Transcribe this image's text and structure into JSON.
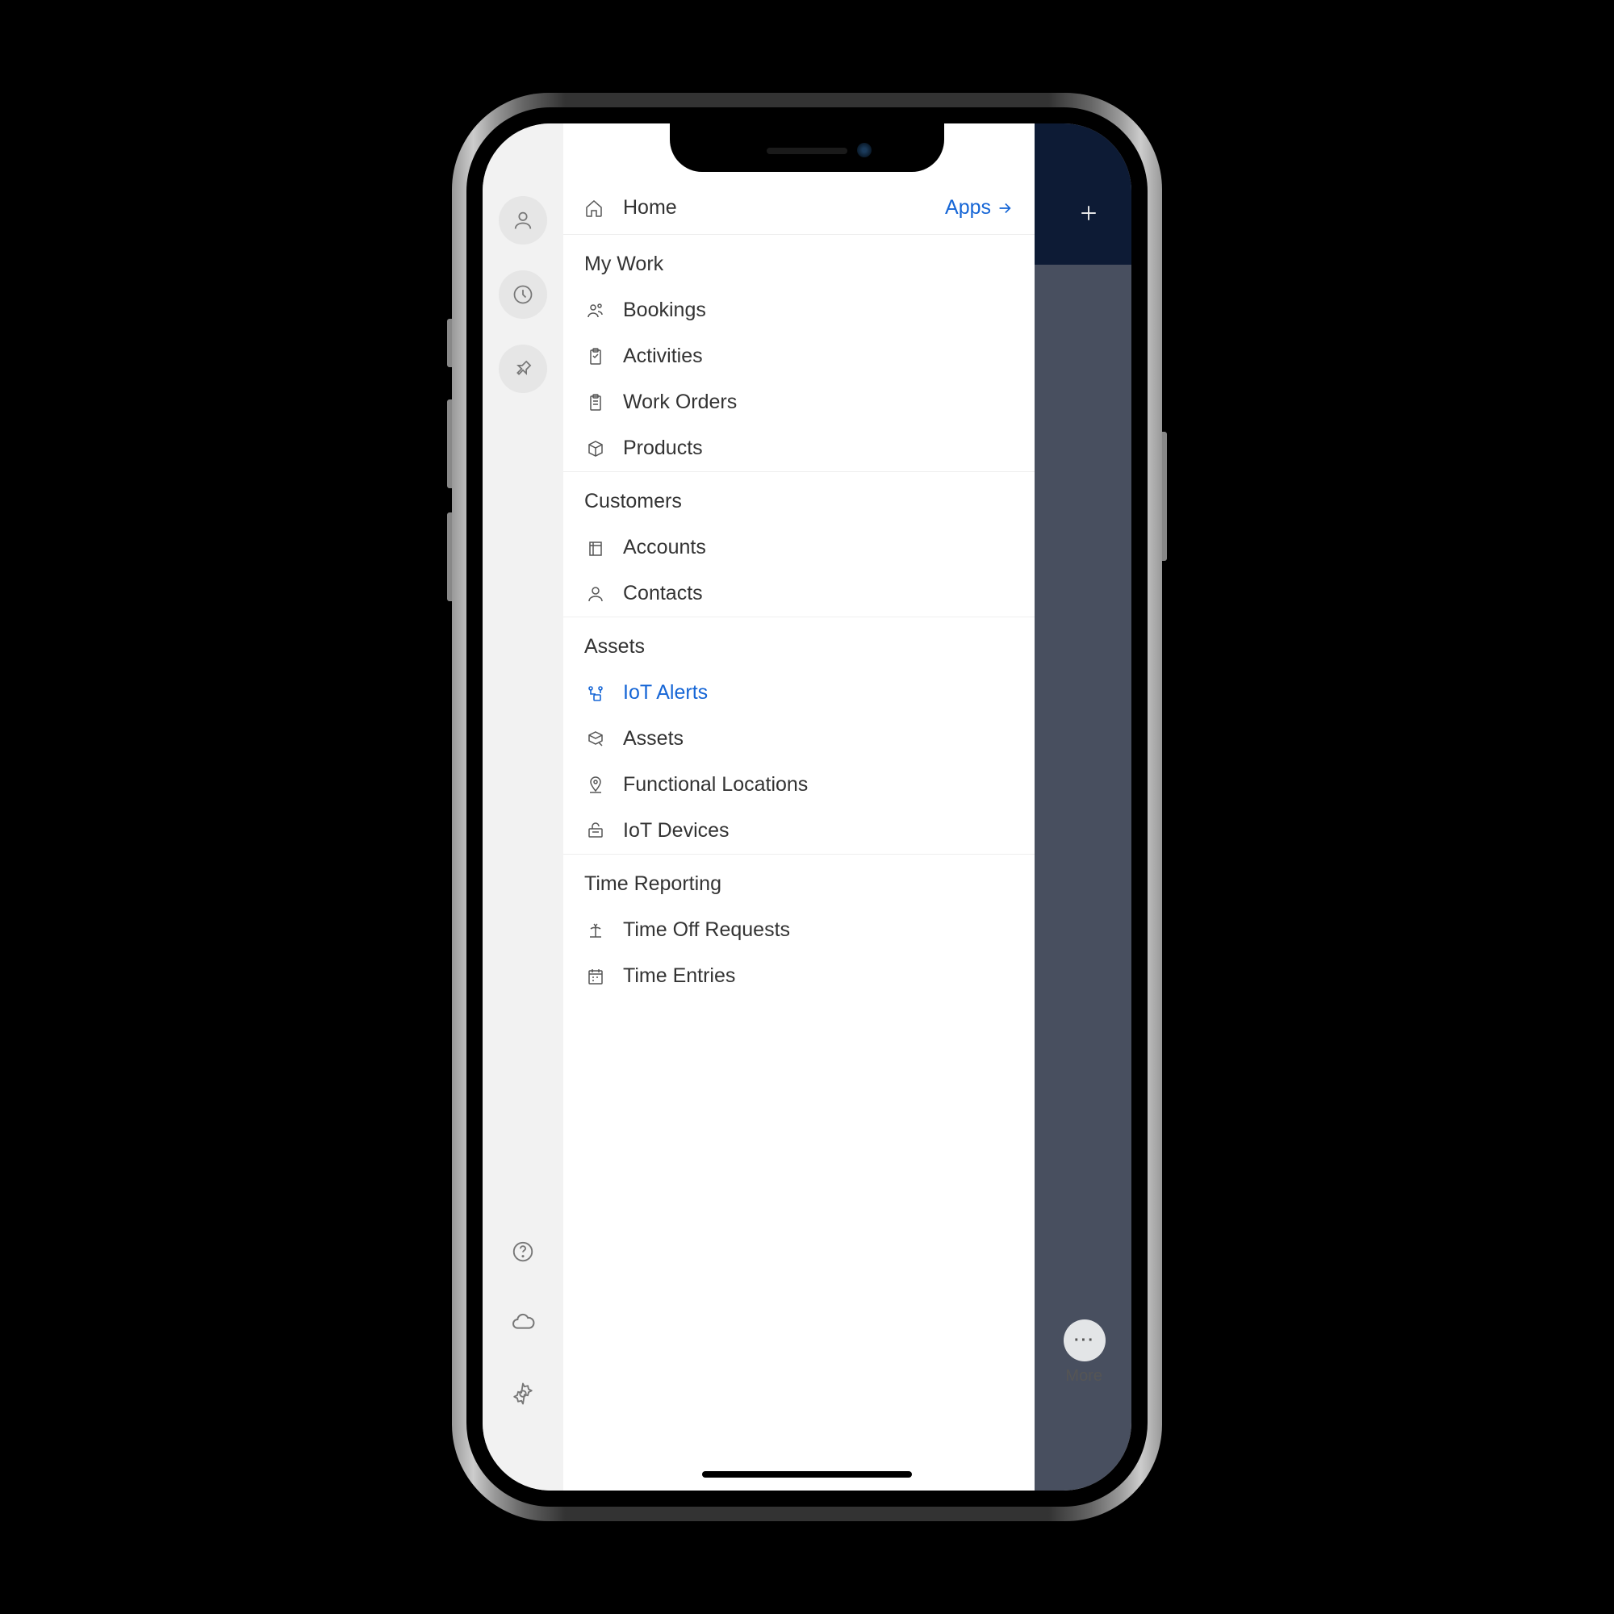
{
  "home_label": "Home",
  "apps_label": "Apps",
  "sections": {
    "my_work": "My Work",
    "customers": "Customers",
    "assets": "Assets",
    "time_reporting": "Time Reporting"
  },
  "items": {
    "bookings": "Bookings",
    "activities": "Activities",
    "work_orders": "Work Orders",
    "products": "Products",
    "accounts": "Accounts",
    "contacts": "Contacts",
    "iot_alerts": "IoT Alerts",
    "assets": "Assets",
    "functional_locations": "Functional Locations",
    "iot_devices": "IoT Devices",
    "time_off_requests": "Time Off Requests",
    "time_entries": "Time Entries"
  },
  "overlay": {
    "more": "More"
  },
  "active_item": "iot_alerts"
}
